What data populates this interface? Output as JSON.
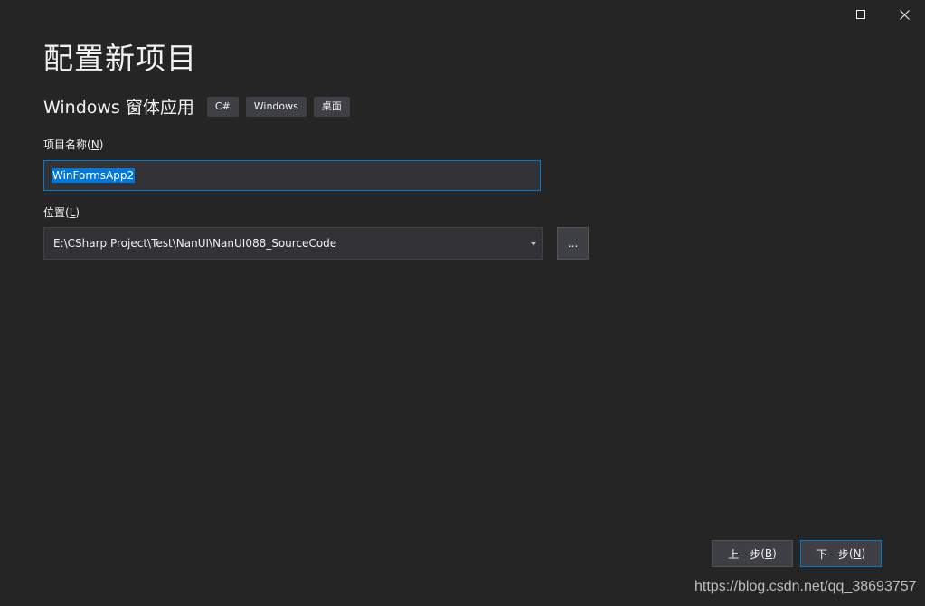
{
  "window_controls": {
    "maximize_icon": "maximize-icon",
    "close_icon": "close-icon"
  },
  "page": {
    "title": "配置新项目",
    "template_name": "Windows 窗体应用",
    "tags": [
      "C#",
      "Windows",
      "桌面"
    ]
  },
  "project_name": {
    "label": "项目名称",
    "accesskey": "N",
    "value": "WinFormsApp2"
  },
  "location": {
    "label": "位置",
    "accesskey": "L",
    "value": "E:\\CSharp Project\\Test\\NanUI\\NanUI088_SourceCode",
    "browse_label": "..."
  },
  "buttons": {
    "back_label": "上一步",
    "back_key": "B",
    "next_label": "下一步",
    "next_key": "N"
  },
  "watermark": "https://blog.csdn.net/qq_38693757",
  "colors": {
    "background": "#252526",
    "input_background": "#333337",
    "accent": "#007acc",
    "selection": "#0078d7",
    "tag_background": "#3f3f46"
  }
}
